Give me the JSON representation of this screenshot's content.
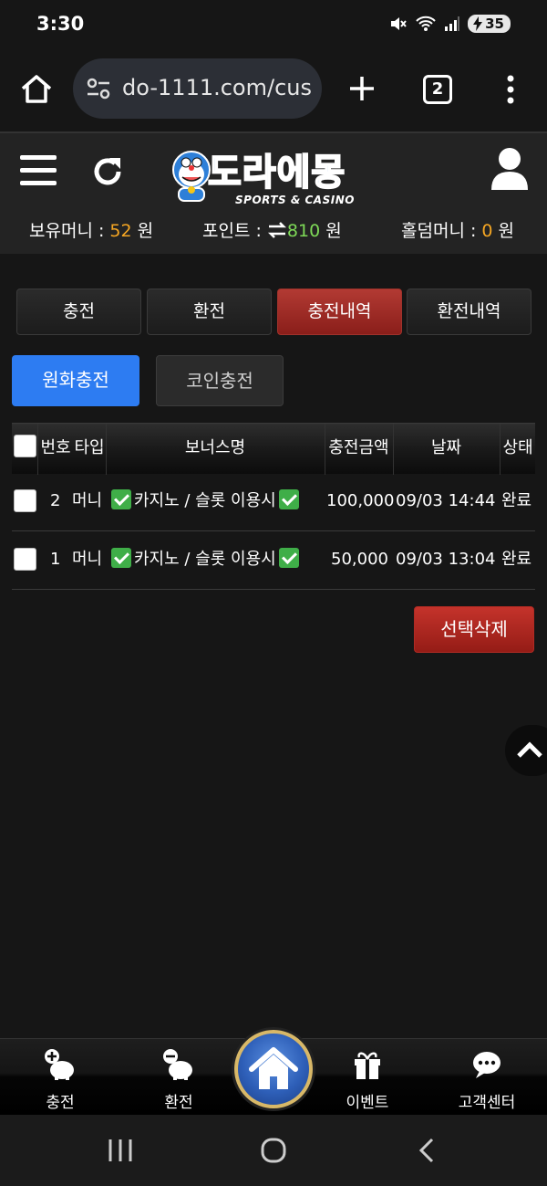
{
  "status_bar": {
    "time": "3:30",
    "battery": "35"
  },
  "browser": {
    "url": "do-1111.com/cus",
    "tab_count": "2"
  },
  "site": {
    "logo_text": "도라에몽",
    "logo_sub": "SPORTS & CASINO",
    "balances": {
      "money_label": "보유머니 : ",
      "money_value": "52",
      "money_unit": " 원",
      "point_label": "포인트 : ",
      "point_value": "810",
      "point_unit": " 원",
      "hold_label": "홀덤머니 : ",
      "hold_value": "0",
      "hold_unit": " 원"
    }
  },
  "tabs": [
    {
      "label": "충전",
      "active": false
    },
    {
      "label": "환전",
      "active": false
    },
    {
      "label": "충전내역",
      "active": true
    },
    {
      "label": "환전내역",
      "active": false
    }
  ],
  "subtabs": [
    {
      "label": "원화충전",
      "selected": true
    },
    {
      "label": "코인충전",
      "selected": false
    }
  ],
  "table": {
    "headers": [
      "번호",
      "타입",
      "보너스명",
      "충전금액",
      "날짜",
      "상태"
    ],
    "rows": [
      {
        "no": "2",
        "type": "머니",
        "bonus": "카지노 / 슬롯 이용시",
        "amount": "100,000",
        "date": "09/03 14:44",
        "status": "완료"
      },
      {
        "no": "1",
        "type": "머니",
        "bonus": "카지노 / 슬롯 이용시",
        "amount": "50,000",
        "date": "09/03 13:04",
        "status": "완료"
      }
    ]
  },
  "delete_button": "선택삭제",
  "bottom_nav": {
    "items": [
      {
        "label": "충전",
        "icon": "piggy-plus-icon"
      },
      {
        "label": "환전",
        "icon": "piggy-minus-icon"
      },
      {
        "label": "이벤트",
        "icon": "gift-icon"
      },
      {
        "label": "고객센터",
        "icon": "chat-support-icon"
      }
    ],
    "home_icon": "home-icon"
  },
  "colors": {
    "accent_red": "#a8291f",
    "accent_blue": "#2d7cf2",
    "orange": "#f5a623",
    "green": "#7ed957"
  }
}
